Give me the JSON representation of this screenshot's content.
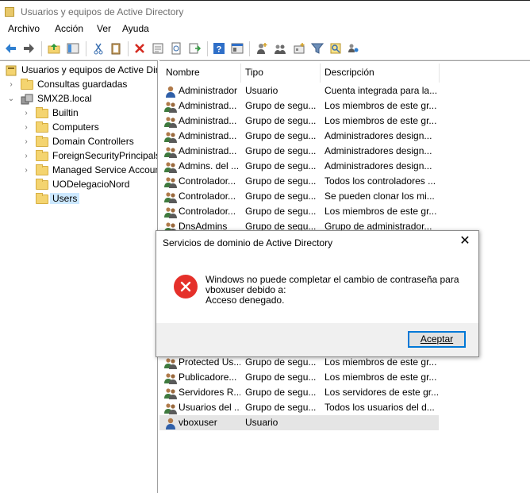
{
  "window": {
    "title": "Usuarios y equipos de Active Directory"
  },
  "menu": [
    "Archivo",
    "Acción",
    "Ver",
    "Ayuda"
  ],
  "tree": {
    "root": "Usuarios y equipos de Active Directory",
    "saved_queries": "Consultas guardadas",
    "domain": "SMX2B.local",
    "children": [
      "Builtin",
      "Computers",
      "Domain Controllers",
      "ForeignSecurityPrincipals",
      "Managed Service Accounts",
      "UODelegacioNord",
      "Users"
    ],
    "selected": "Users"
  },
  "list": {
    "columns": [
      "Nombre",
      "Tipo",
      "Descripción"
    ],
    "rows_top": [
      {
        "name": "Administrador",
        "type": "Usuario",
        "desc": "Cuenta integrada para la...",
        "kind": "user"
      },
      {
        "name": "Administrad...",
        "type": "Grupo de segu...",
        "desc": "Los miembros de este gr...",
        "kind": "group"
      },
      {
        "name": "Administrad...",
        "type": "Grupo de segu...",
        "desc": "Los miembros de este gr...",
        "kind": "group"
      },
      {
        "name": "Administrad...",
        "type": "Grupo de segu...",
        "desc": "Administradores design...",
        "kind": "group"
      },
      {
        "name": "Administrad...",
        "type": "Grupo de segu...",
        "desc": "Administradores design...",
        "kind": "group"
      },
      {
        "name": "Admins. del ...",
        "type": "Grupo de segu...",
        "desc": "Administradores design...",
        "kind": "group"
      },
      {
        "name": "Controlador...",
        "type": "Grupo de segu...",
        "desc": "Todos los controladores ...",
        "kind": "group"
      },
      {
        "name": "Controlador...",
        "type": "Grupo de segu...",
        "desc": "Se pueden clonar los mi...",
        "kind": "group"
      },
      {
        "name": "Controlador...",
        "type": "Grupo de segu...",
        "desc": "Los miembros de este gr...",
        "kind": "group"
      },
      {
        "name": "DnsAdmins",
        "type": "Grupo de segu...",
        "desc": "Grupo de administrador...",
        "kind": "group"
      }
    ],
    "rows_bottom": [
      {
        "name": "Protected Us...",
        "type": "Grupo de segu...",
        "desc": "Los miembros de este gr...",
        "kind": "group"
      },
      {
        "name": "Publicadore...",
        "type": "Grupo de segu...",
        "desc": "Los miembros de este gr...",
        "kind": "group"
      },
      {
        "name": "Servidores R...",
        "type": "Grupo de segu...",
        "desc": "Los servidores de este gr...",
        "kind": "group"
      },
      {
        "name": "Usuarios del ...",
        "type": "Grupo de segu...",
        "desc": "Todos los usuarios del d...",
        "kind": "group"
      },
      {
        "name": "vboxuser",
        "type": "Usuario",
        "desc": "",
        "kind": "user"
      }
    ]
  },
  "dialog": {
    "title": "Servicios de dominio de Active Directory",
    "message_line1": "Windows no puede completar el cambio de contraseña para",
    "message_line2": "vboxuser debido a:",
    "message_line3": "Acceso denegado.",
    "button": "Aceptar",
    "icon": "error-icon"
  },
  "colors": {
    "selection": "#cce8ff",
    "error_red": "#e5302a",
    "accent_blue": "#0078d7"
  }
}
